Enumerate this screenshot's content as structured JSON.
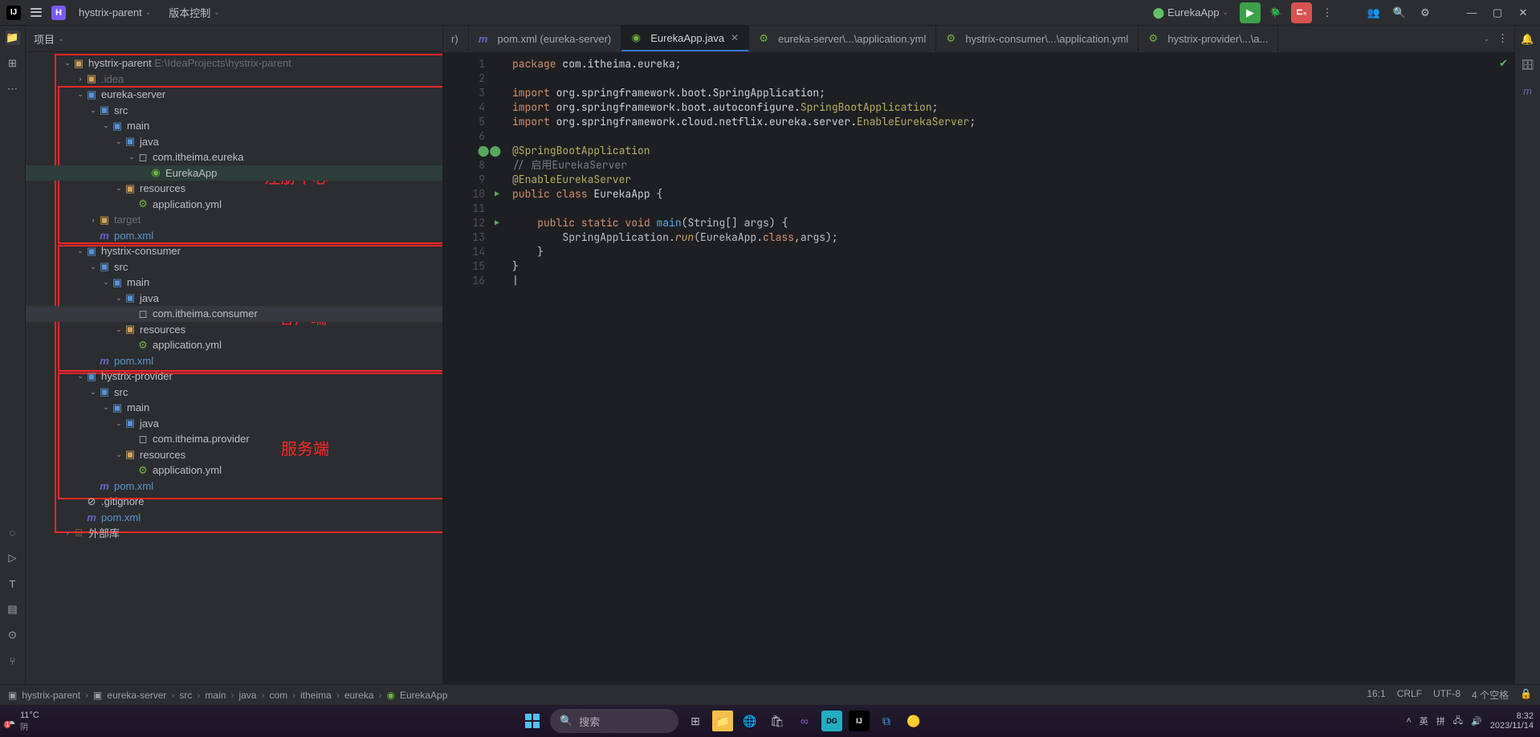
{
  "title_bar": {
    "project_badge": "H",
    "project_name": "hystrix-parent",
    "menu_vcs": "版本控制",
    "run_config": "EurekaApp"
  },
  "panel": {
    "label": "项目"
  },
  "tree": {
    "root": "hystrix-parent",
    "root_path": "E:\\IdeaProjects\\hystrix-parent",
    "idea": ".idea",
    "eureka_server": "eureka-server",
    "src": "src",
    "main": "main",
    "java": "java",
    "pkg_eureka": "com.itheima.eureka",
    "eureka_app": "EurekaApp",
    "resources": "resources",
    "app_yml": "application.yml",
    "target": "target",
    "pom": "pom.xml",
    "hystrix_consumer": "hystrix-consumer",
    "pkg_consumer": "com.itheima.consumer",
    "hystrix_provider": "hystrix-provider",
    "pkg_provider": "com.itheima.provider",
    "gitignore": ".gitignore",
    "ext_lib": "外部库"
  },
  "annotations": {
    "a1": "注册中心",
    "a2": "客户端",
    "a3": "服务端"
  },
  "tabs": {
    "t0": "r)",
    "t1": "pom.xml (eureka-server)",
    "t2": "EurekaApp.java",
    "t3": "eureka-server\\...\\application.yml",
    "t4": "hystrix-consumer\\...\\application.yml",
    "t5": "hystrix-provider\\...\\a..."
  },
  "code_lines": {
    "1": "package com.itheima.eureka;",
    "2": "",
    "3": "import org.springframework.boot.SpringApplication;",
    "4": "import org.springframework.boot.autoconfigure.SpringBootApplication;",
    "5": "import org.springframework.cloud.netflix.eureka.server.EnableEurekaServer;",
    "6": "",
    "7": "@SpringBootApplication",
    "8": "// 启用EurekaServer",
    "9": "@EnableEurekaServer",
    "10": "public class EurekaApp {",
    "11": "",
    "12": "    public static void main(String[] args) {",
    "13": "        SpringApplication.run(EurekaApp.class,args);",
    "14": "    }",
    "15": "}",
    "16": ""
  },
  "status": {
    "crumbs": [
      "hystrix-parent",
      "eureka-server",
      "src",
      "main",
      "java",
      "com",
      "itheima",
      "eureka",
      "EurekaApp"
    ],
    "pos": "16:1",
    "eol": "CRLF",
    "enc": "UTF-8",
    "indent": "4 个空格"
  },
  "taskbar": {
    "temp": "11°C",
    "cond": "阴",
    "search_ph": "搜索",
    "ime1": "英",
    "ime2": "拼",
    "time": "8:32",
    "date": "2023/11/14"
  }
}
